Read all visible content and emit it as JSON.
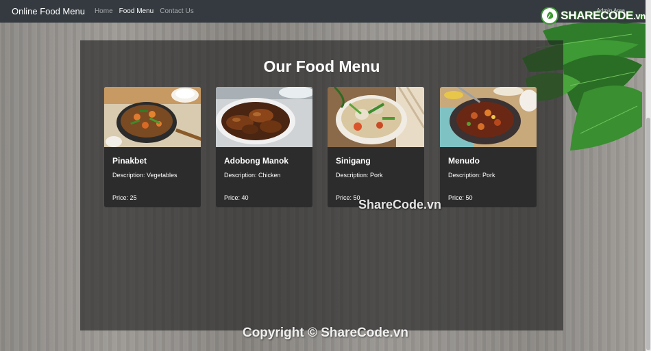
{
  "navbar": {
    "brand": "Online Food Menu",
    "links": [
      {
        "label": "Home",
        "active": false
      },
      {
        "label": "Food Menu",
        "active": true
      },
      {
        "label": "Contact Us",
        "active": false
      }
    ],
    "admin_link": "Admin Area",
    "bg_color": "#343a40"
  },
  "logo": {
    "text": "SHARECODE",
    "suffix": ".vn"
  },
  "main": {
    "title": "Our Food Menu",
    "cards": [
      {
        "name": "Pinakbet",
        "description": "Description: Vegetables",
        "price": "Price: 25"
      },
      {
        "name": "Adobong Manok",
        "description": "Description: Chicken",
        "price": "Price: 40"
      },
      {
        "name": "Sinigang",
        "description": "Description: Pork",
        "price": "Price: 50"
      },
      {
        "name": "Menudo",
        "description": "Description: Pork",
        "price": "Price: 50"
      }
    ]
  },
  "watermarks": {
    "middle": "ShareCode.vn",
    "bottom": "Copyright © ShareCode.vn"
  }
}
